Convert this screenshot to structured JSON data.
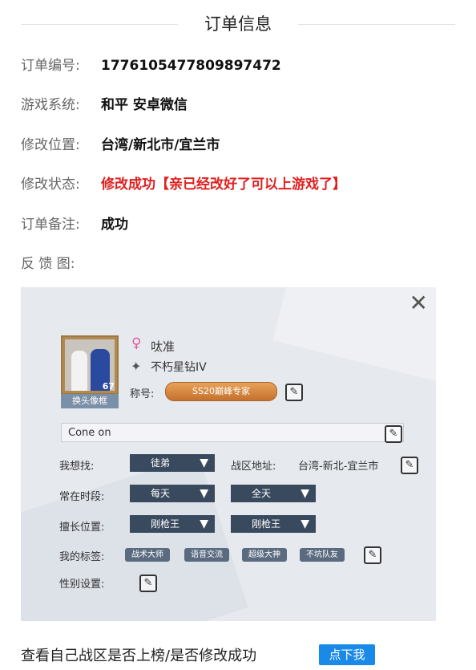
{
  "header": {
    "title": "订单信息"
  },
  "fields": [
    {
      "label": "订单编号:",
      "value": "1776105477809897472"
    },
    {
      "label": "游戏系统:",
      "value": "和平 安卓微信"
    },
    {
      "label": "修改位置:",
      "value": "台湾/新北市/宜兰市"
    },
    {
      "label": "修改状态:",
      "value": "修改成功【亲已经改好了可以上游戏了】"
    },
    {
      "label": "订单备注:",
      "value": "成功"
    }
  ],
  "feedback_label": "反 馈 图:",
  "screenshot": {
    "close": "✕",
    "avatar_level": "67",
    "swap_frame": "换头像框",
    "player_name": "呔准",
    "rank": "不朽星钻IV",
    "title_label": "称号:",
    "title_badge": "SS20巅峰专家",
    "signature": "Cone on",
    "looking_for_label": "我想找:",
    "looking_for_value": "徒弟",
    "zone_label": "战区地址:",
    "zone_value": "台湾-新北-宜兰市",
    "active_time_label": "常在时段:",
    "active_day": "每天",
    "active_time": "全天",
    "position_label": "擅长位置:",
    "position_1": "刚枪王",
    "position_2": "刚枪王",
    "tags_label": "我的标签:",
    "tags": [
      "战术大师",
      "语音交流",
      "超级大神",
      "不坑队友"
    ],
    "gender_label": "性别设置:"
  },
  "bottom": {
    "text": "查看自己战区是否上榜/是否修改成功",
    "button": "点下我"
  },
  "colors": {
    "status_red": "#e02020",
    "button_blue": "#1a8ae8"
  }
}
